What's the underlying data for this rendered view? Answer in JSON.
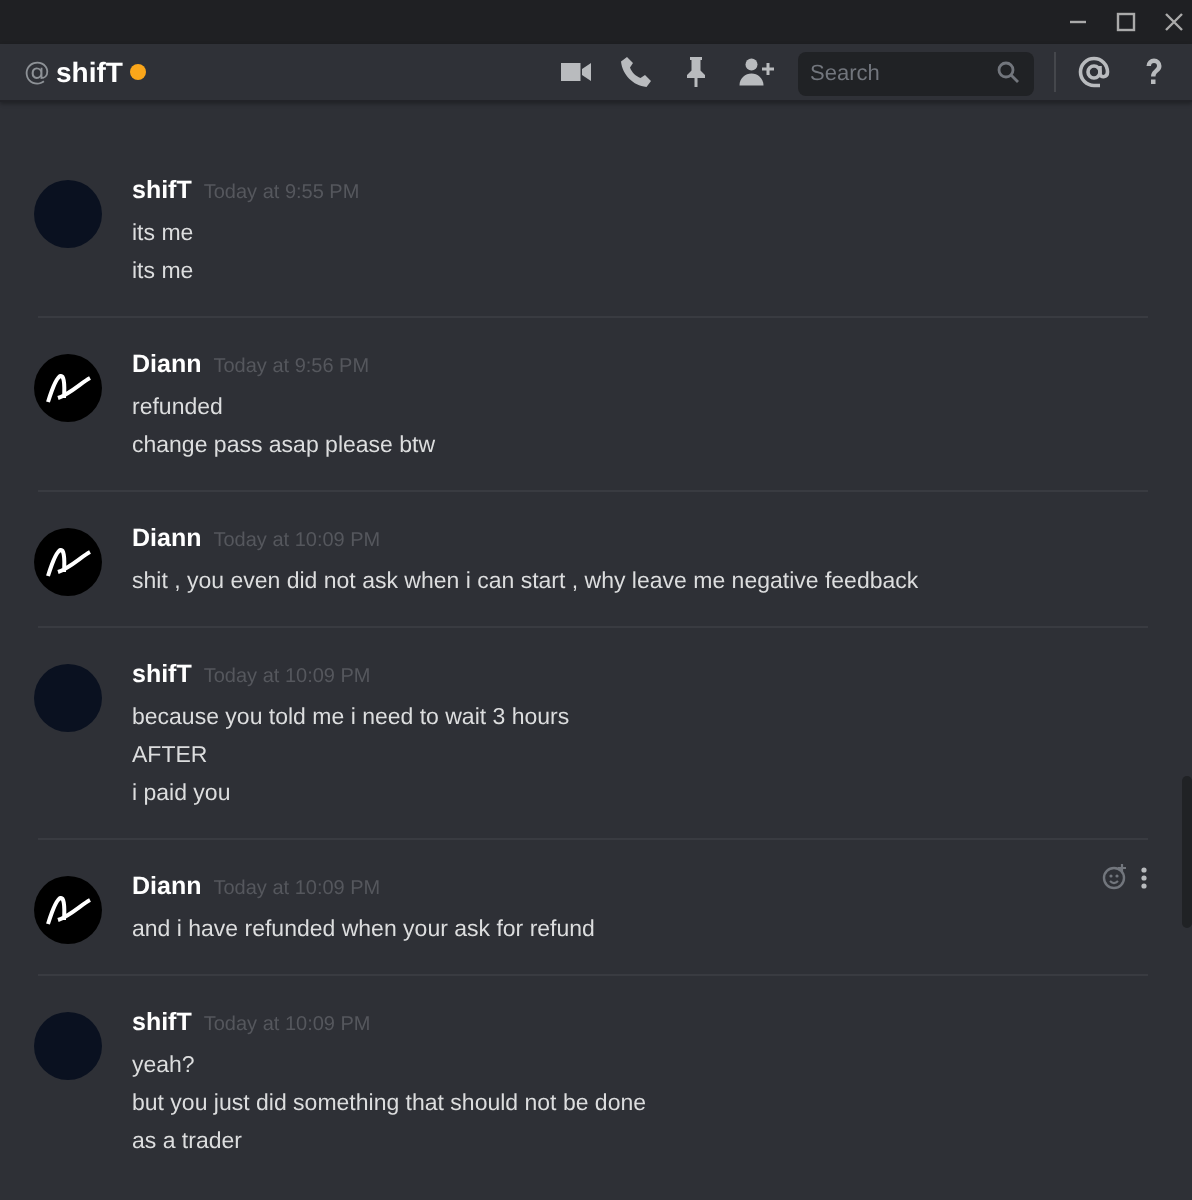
{
  "header": {
    "at": "@",
    "title": "shifT",
    "search": {
      "placeholder": "Search"
    }
  },
  "messages": [
    {
      "author": "shifT",
      "kind": "plain",
      "time": "Today at 9:55 PM",
      "hovered": false,
      "lines": [
        "its me",
        "its me"
      ]
    },
    {
      "author": "Diann",
      "kind": "logo",
      "time": "Today at 9:56 PM",
      "hovered": false,
      "lines": [
        "refunded",
        "change pass asap please btw"
      ]
    },
    {
      "author": "Diann",
      "kind": "logo",
      "time": "Today at 10:09 PM",
      "hovered": false,
      "lines": [
        "shit , you even did not ask when i can start ,  why leave me negative feedback"
      ]
    },
    {
      "author": "shifT",
      "kind": "plain",
      "time": "Today at 10:09 PM",
      "hovered": false,
      "lines": [
        "because you told me i need to wait 3 hours",
        "AFTER",
        "i paid you"
      ]
    },
    {
      "author": "Diann",
      "kind": "logo",
      "time": "Today at 10:09 PM",
      "hovered": true,
      "lines": [
        "and i have refunded when your ask for refund"
      ]
    },
    {
      "author": "shifT",
      "kind": "plain",
      "time": "Today at 10:09 PM",
      "hovered": false,
      "lines": [
        "yeah?",
        "but you just did something that should not be done",
        "as a trader"
      ]
    }
  ]
}
